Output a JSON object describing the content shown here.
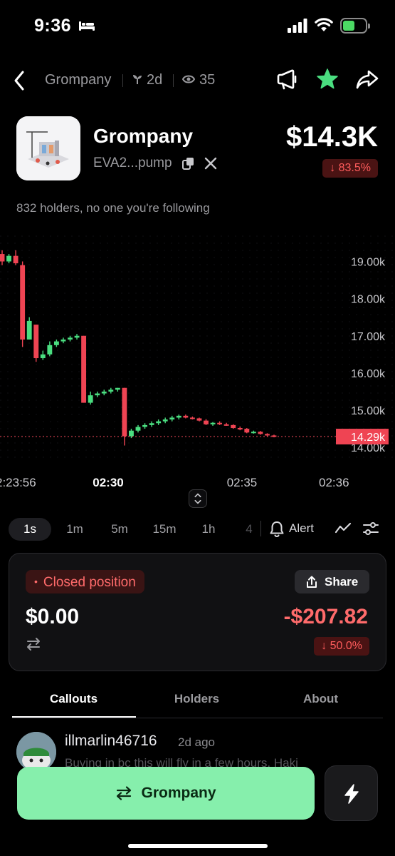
{
  "status_bar": {
    "time": "9:36"
  },
  "nav": {
    "token_name": "Grompany",
    "age": "2d",
    "views": "35"
  },
  "token": {
    "name": "Grompany",
    "address": "EVA2...pump",
    "price": "$14.3K",
    "change": "↓ 83.5%",
    "holders_text": "832 holders, no one you're following"
  },
  "chart": {
    "y_ticks": [
      "19.00k",
      "18.00k",
      "17.00k",
      "16.00k",
      "15.00k",
      "14.00k"
    ],
    "x_ticks": [
      "2:23:56",
      "02:30",
      "02:35",
      "02:36"
    ],
    "current_price_label": "14.29k"
  },
  "chart_data": {
    "type": "candlestick",
    "title": "",
    "ylim": [
      13.6,
      19.7
    ],
    "current_price": 14.29,
    "y_ticks": [
      19.0,
      18.0,
      17.0,
      16.0,
      15.0,
      14.0
    ],
    "x_tick_labels": [
      "2:23:56",
      "02:30",
      "02:35",
      "02:36"
    ],
    "candles": [
      {
        "o": 19.2,
        "h": 19.3,
        "l": 18.9,
        "c": 19.0
      },
      {
        "o": 19.0,
        "h": 19.2,
        "l": 18.95,
        "c": 19.15
      },
      {
        "o": 19.15,
        "h": 19.3,
        "l": 18.9,
        "c": 18.95
      },
      {
        "o": 18.9,
        "h": 19.0,
        "l": 16.7,
        "c": 16.9
      },
      {
        "o": 16.9,
        "h": 17.5,
        "l": 16.9,
        "c": 17.4
      },
      {
        "o": 17.3,
        "h": 17.3,
        "l": 16.3,
        "c": 16.4
      },
      {
        "o": 16.4,
        "h": 16.6,
        "l": 16.35,
        "c": 16.5
      },
      {
        "o": 16.5,
        "h": 16.85,
        "l": 16.45,
        "c": 16.75
      },
      {
        "o": 16.75,
        "h": 16.9,
        "l": 16.7,
        "c": 16.85
      },
      {
        "o": 16.85,
        "h": 16.95,
        "l": 16.8,
        "c": 16.9
      },
      {
        "o": 16.9,
        "h": 17.0,
        "l": 16.85,
        "c": 16.95
      },
      {
        "o": 16.95,
        "h": 17.05,
        "l": 16.9,
        "c": 17.0
      },
      {
        "o": 17.0,
        "h": 17.0,
        "l": 15.2,
        "c": 15.2
      },
      {
        "o": 15.2,
        "h": 15.5,
        "l": 15.15,
        "c": 15.4
      },
      {
        "o": 15.4,
        "h": 15.5,
        "l": 15.35,
        "c": 15.45
      },
      {
        "o": 15.45,
        "h": 15.55,
        "l": 15.4,
        "c": 15.5
      },
      {
        "o": 15.5,
        "h": 15.6,
        "l": 15.45,
        "c": 15.55
      },
      {
        "o": 15.55,
        "h": 15.6,
        "l": 15.5,
        "c": 15.6
      },
      {
        "o": 15.6,
        "h": 15.6,
        "l": 14.05,
        "c": 14.3
      },
      {
        "o": 14.3,
        "h": 14.5,
        "l": 14.25,
        "c": 14.45
      },
      {
        "o": 14.45,
        "h": 14.6,
        "l": 14.4,
        "c": 14.55
      },
      {
        "o": 14.55,
        "h": 14.65,
        "l": 14.5,
        "c": 14.6
      },
      {
        "o": 14.6,
        "h": 14.7,
        "l": 14.55,
        "c": 14.65
      },
      {
        "o": 14.65,
        "h": 14.75,
        "l": 14.6,
        "c": 14.7
      },
      {
        "o": 14.7,
        "h": 14.8,
        "l": 14.65,
        "c": 14.75
      },
      {
        "o": 14.75,
        "h": 14.85,
        "l": 14.7,
        "c": 14.8
      },
      {
        "o": 14.8,
        "h": 14.88,
        "l": 14.75,
        "c": 14.85
      },
      {
        "o": 14.85,
        "h": 14.88,
        "l": 14.78,
        "c": 14.8
      },
      {
        "o": 14.8,
        "h": 14.83,
        "l": 14.75,
        "c": 14.78
      },
      {
        "o": 14.78,
        "h": 14.8,
        "l": 14.7,
        "c": 14.72
      },
      {
        "o": 14.72,
        "h": 14.76,
        "l": 14.6,
        "c": 14.62
      },
      {
        "o": 14.62,
        "h": 14.68,
        "l": 14.58,
        "c": 14.66
      },
      {
        "o": 14.66,
        "h": 14.7,
        "l": 14.6,
        "c": 14.62
      },
      {
        "o": 14.62,
        "h": 14.66,
        "l": 14.58,
        "c": 14.6
      },
      {
        "o": 14.6,
        "h": 14.62,
        "l": 14.5,
        "c": 14.52
      },
      {
        "o": 14.52,
        "h": 14.56,
        "l": 14.46,
        "c": 14.5
      },
      {
        "o": 14.5,
        "h": 14.52,
        "l": 14.38,
        "c": 14.4
      },
      {
        "o": 14.4,
        "h": 14.45,
        "l": 14.37,
        "c": 14.42
      },
      {
        "o": 14.42,
        "h": 14.44,
        "l": 14.34,
        "c": 14.36
      },
      {
        "o": 14.36,
        "h": 14.38,
        "l": 14.3,
        "c": 14.32
      },
      {
        "o": 14.32,
        "h": 14.34,
        "l": 14.27,
        "c": 14.29
      }
    ]
  },
  "timeframes": {
    "active": "1s",
    "items": [
      "1s",
      "1m",
      "5m",
      "15m",
      "1h",
      "4"
    ],
    "alert_label": "Alert"
  },
  "position": {
    "status": "Closed position",
    "share_label": "Share",
    "value": "$0.00",
    "pnl": "-$207.82",
    "pnl_pct": "↓ 50.0%"
  },
  "tabs": {
    "items": [
      "Callouts",
      "Holders",
      "About"
    ],
    "active": "Callouts"
  },
  "callout": {
    "username": "illmarlin46716",
    "time": "2d ago",
    "text": "Buying in bc this will fly in a few hours. Haki"
  },
  "buy_button": {
    "label": "Grompany"
  },
  "colors": {
    "up": "#4ade80",
    "down": "#ef4453",
    "accent": "#86efac",
    "price_line": "#ef4453"
  }
}
